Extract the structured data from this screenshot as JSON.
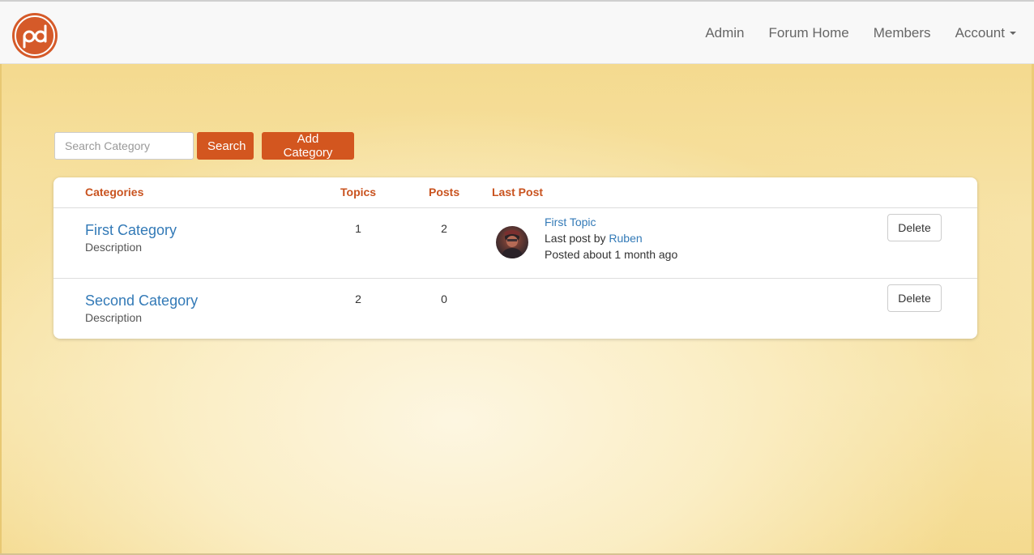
{
  "app": {
    "logo_text": "pd",
    "brand_color": "#d3561f"
  },
  "nav": {
    "items": [
      {
        "label": "Admin"
      },
      {
        "label": "Forum Home"
      },
      {
        "label": "Members"
      },
      {
        "label": "Account"
      }
    ]
  },
  "toolbar": {
    "search_placeholder": "Search Category",
    "search_value": "",
    "search_button": "Search",
    "add_button": "Add Category"
  },
  "table": {
    "headers": {
      "categories": "Categories",
      "topics": "Topics",
      "posts": "Posts",
      "last_post": "Last Post"
    },
    "rows": [
      {
        "name": "First Category",
        "description": "Description",
        "topics": "1",
        "posts": "2",
        "last_post": {
          "topic": "First Topic",
          "by_prefix": "Last post by",
          "author": "Ruben",
          "time": "Posted about 1 month ago"
        },
        "action": "Delete"
      },
      {
        "name": "Second Category",
        "description": "Description",
        "topics": "2",
        "posts": "0",
        "action": "Delete"
      }
    ]
  }
}
